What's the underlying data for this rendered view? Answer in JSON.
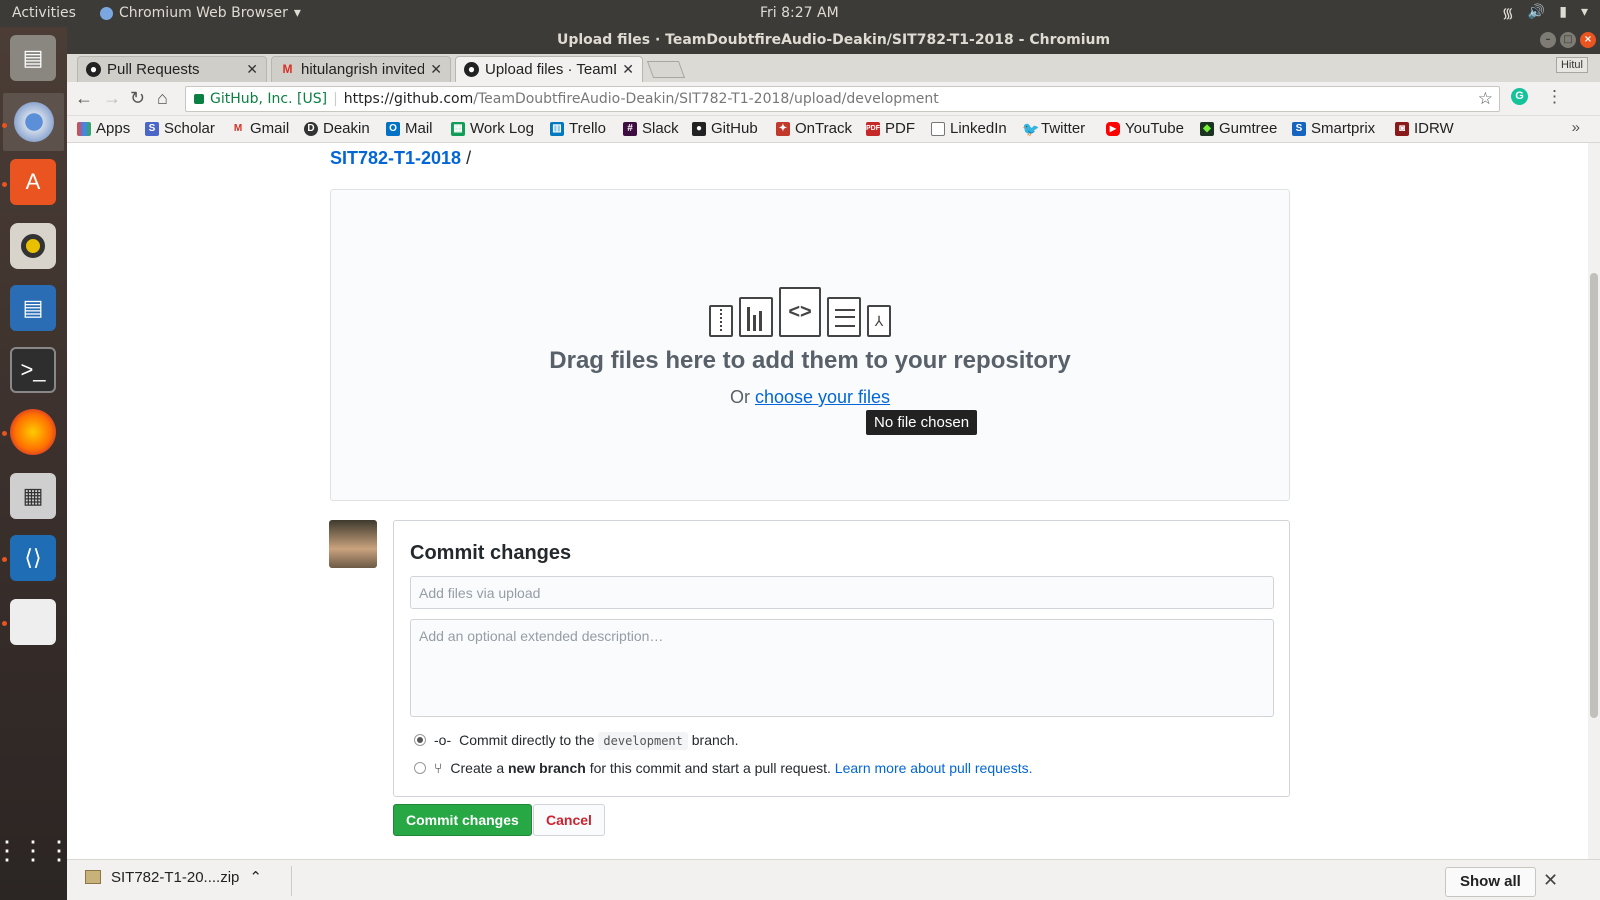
{
  "topbar": {
    "activities": "Activities",
    "app_name": "Chromium Web Browser",
    "clock": "Fri  8:27 AM"
  },
  "window": {
    "title": "Upload files · TeamDoubtfireAudio-Deakin/SIT782-T1-2018 - Chromium"
  },
  "tabs": [
    {
      "label": "Pull Requests"
    },
    {
      "label": "hitulangrish invited"
    },
    {
      "label": "Upload files · TeamD"
    }
  ],
  "profile": "Hitul",
  "address": {
    "security": "GitHub, Inc. [US]",
    "host": "https://github.com",
    "path": "/TeamDoubtfireAudio-Deakin/SIT782-T1-2018/upload/development"
  },
  "bookmarks": [
    "Apps",
    "Scholar",
    "Gmail",
    "Deakin",
    "Mail",
    "Work Log",
    "Trello",
    "Slack",
    "GitHub",
    "OnTrack",
    "PDF",
    "LinkedIn",
    "Twitter",
    "YouTube",
    "Gumtree",
    "Smartprix",
    "IDRW"
  ],
  "page": {
    "breadcrumb_repo": "SIT782-T1-2018",
    "breadcrumb_sep": "/",
    "drop_title": "Drag files here to add them to your repository",
    "drop_or": "Or",
    "drop_link": "choose your files",
    "tooltip": "No file chosen",
    "commit_heading": "Commit changes",
    "summary_placeholder": "Add files via upload",
    "description_placeholder": "Add an optional extended description…",
    "radio1_pre": "Commit directly to the",
    "radio1_branch": "development",
    "radio1_post": "branch.",
    "radio2_pre": "Create a",
    "radio2_bold": "new branch",
    "radio2_post": "for this commit and start a pull request.",
    "radio2_link": "Learn more about pull requests.",
    "commit_button": "Commit changes",
    "cancel_button": "Cancel"
  },
  "download": {
    "filename": "SIT782-T1-20....zip",
    "show_all": "Show all"
  },
  "colors": {
    "github_link": "#0366d6",
    "commit_green": "#28a745",
    "ubuntu_orange": "#e95420"
  }
}
